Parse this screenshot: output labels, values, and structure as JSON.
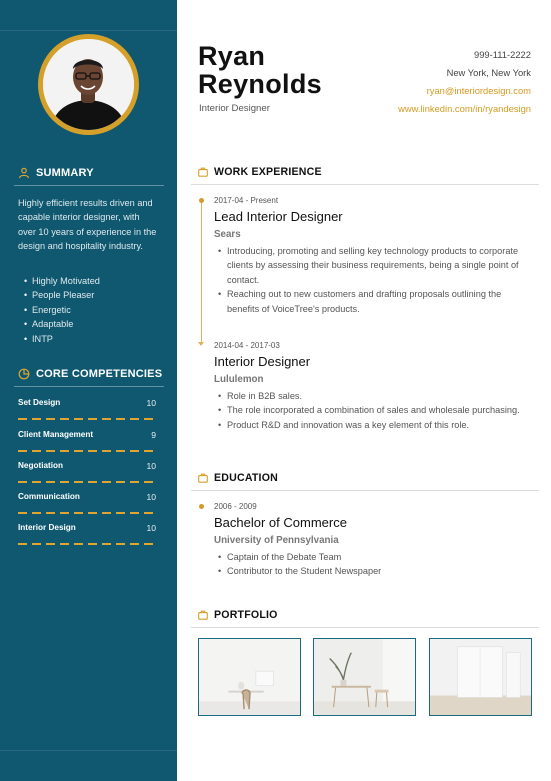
{
  "header": {
    "first_name": "Ryan",
    "last_name": "Reynolds",
    "role": "Interior Designer",
    "phone": "999-111-2222",
    "location": "New York, New York",
    "email": "ryan@interiordesign.com",
    "linkedin": "www.linkedin.com/in/ryandesign"
  },
  "sidebar": {
    "summary_heading": "SUMMARY",
    "summary_text": "Highly efficient results driven and capable interior designer, with over 10 years of experience in the design and hospitality industry.",
    "traits": [
      "Highly Motivated",
      "People Pleaser",
      "Energetic",
      "Adaptable",
      "INTP"
    ],
    "competencies_heading": "CORE COMPETENCIES",
    "competencies": [
      {
        "name": "Set Design",
        "value": "10"
      },
      {
        "name": "Client Management",
        "value": "9"
      },
      {
        "name": "Negotiation",
        "value": "10"
      },
      {
        "name": "Communication",
        "value": "10"
      },
      {
        "name": "Interior Design",
        "value": "10"
      }
    ]
  },
  "work": {
    "heading": "WORK EXPERIENCE",
    "jobs": [
      {
        "date": "2017-04 - Present",
        "title": "Lead Interior Designer",
        "company": "Sears",
        "bullets": [
          "Introducing, promoting and selling key technology products to corporate clients by assessing their business requirements, being a single point of contact.",
          "Reaching out to new customers and drafting proposals outlining the benefits of VoiceTree's products."
        ]
      },
      {
        "date": "2014-04 - 2017-03",
        "title": "Interior Designer",
        "company": "Lululemon",
        "bullets": [
          "Role in B2B sales.",
          "The role incorporated a combination of sales and wholesale purchasing.",
          "Product R&D and innovation was a key element of this role."
        ]
      }
    ]
  },
  "education": {
    "heading": "EDUCATION",
    "date": "2006 - 2009",
    "degree": "Bachelor of Commerce",
    "school": "University of Pennsylvania",
    "bullets": [
      "Captain of the Debate Team",
      "Contributor to the Student Newspaper"
    ]
  },
  "portfolio": {
    "heading": "PORTFOLIO"
  },
  "colors": {
    "sidebar": "#0f5870",
    "accent": "#d4a02a"
  },
  "icons": {
    "summary": "person-icon",
    "competencies": "pie-chart-icon",
    "work": "briefcase-icon",
    "education": "briefcase-icon",
    "portfolio": "briefcase-icon"
  }
}
